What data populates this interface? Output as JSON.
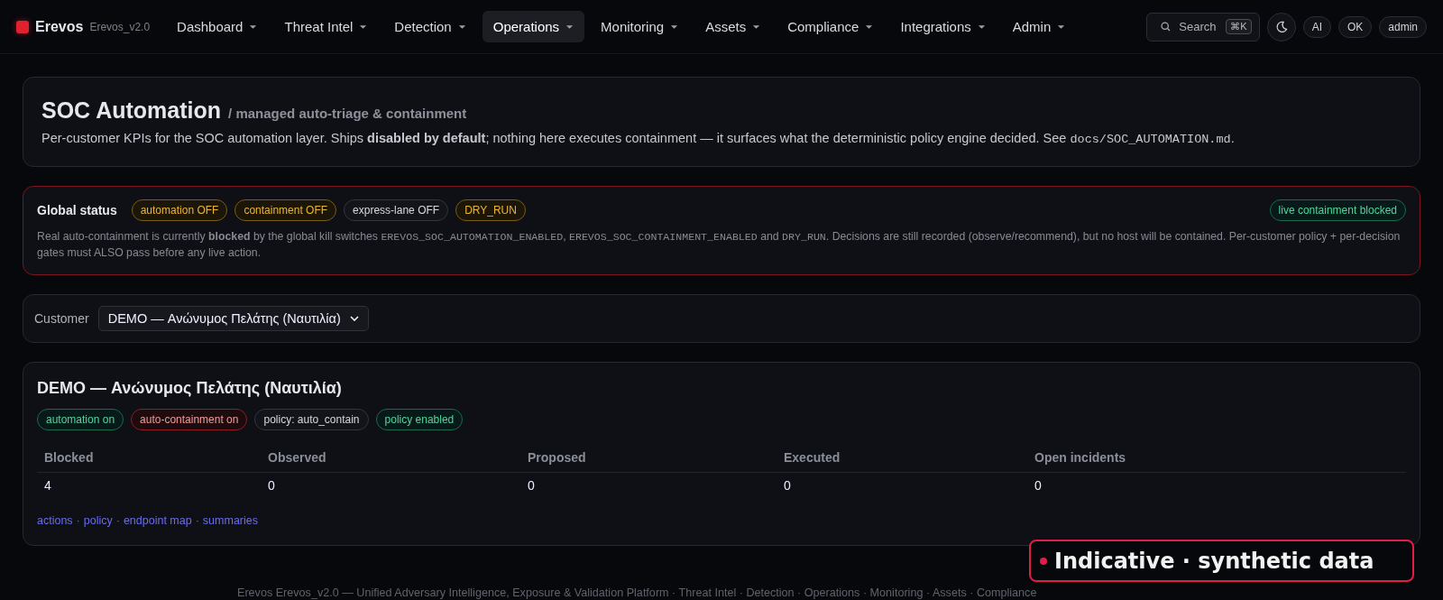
{
  "brand": {
    "name": "Erevos",
    "version": "Erevos_v2.0"
  },
  "nav": [
    {
      "label": "Dashboard",
      "selected": false
    },
    {
      "label": "Threat Intel",
      "selected": false
    },
    {
      "label": "Detection",
      "selected": false
    },
    {
      "label": "Operations",
      "selected": true
    },
    {
      "label": "Monitoring",
      "selected": false
    },
    {
      "label": "Assets",
      "selected": false
    },
    {
      "label": "Compliance",
      "selected": false
    },
    {
      "label": "Integrations",
      "selected": false
    },
    {
      "label": "Admin",
      "selected": false
    }
  ],
  "search": {
    "placeholder": "Search",
    "shortcut": "⌘K"
  },
  "header_buttons": [
    "AI",
    "OK",
    "admin"
  ],
  "header": {
    "title": "SOC Automation",
    "subtitle": "/ managed auto-triage & containment",
    "intro": [
      {
        "kind": "text",
        "text": "Per-customer KPIs for the SOC automation layer. Ships **disabled by default**; nothing here executes containment — it surfaces what the deterministic policy engine decided. See "
      },
      {
        "kind": "code",
        "text": "docs/SOC_AUTOMATION.md"
      },
      {
        "kind": "text",
        "text": "."
      }
    ]
  },
  "global_status": {
    "title": "Global status",
    "chips": [
      {
        "label": "automation OFF",
        "kind": "warn"
      },
      {
        "label": "containment OFF",
        "kind": "warn"
      },
      {
        "label": "express-lane OFF",
        "kind": "neutral"
      },
      {
        "label": "DRY_RUN",
        "kind": "warn"
      }
    ],
    "result": {
      "label": "live containment blocked",
      "kind": "ok"
    },
    "text": [
      {
        "kind": "text",
        "text": "Real auto-containment is currently **blocked** by the global kill switches "
      },
      {
        "kind": "code",
        "text": "EREVOS_SOC_AUTOMATION_ENABLED"
      },
      {
        "kind": "text",
        "text": ", "
      },
      {
        "kind": "code",
        "text": "EREVOS_SOC_CONTAINMENT_ENABLED"
      },
      {
        "kind": "text",
        "text": " and "
      },
      {
        "kind": "code",
        "text": "DRY_RUN"
      },
      {
        "kind": "text",
        "text": ". Decisions are still recorded (observe/recommend), but no host will be contained. Per-customer policy + per-decision gates must ALSO pass before any live action."
      }
    ]
  },
  "customer": {
    "label": "Customer",
    "value": "DEMO — Ανώνυμος Πελάτης (Ναυτιλία)"
  },
  "tenant": {
    "title": "DEMO — Ανώνυμος Πελάτης (Ναυτιλία)",
    "chips": [
      {
        "label": "automation on",
        "kind": "ok"
      },
      {
        "label": "auto-containment on",
        "kind": "danger"
      },
      {
        "label": "policy: auto_contain",
        "kind": "neutral"
      },
      {
        "label": "policy enabled",
        "kind": "ok"
      }
    ],
    "columns": [
      "Blocked",
      "Observed",
      "Proposed",
      "Executed",
      "Open incidents"
    ],
    "values": [
      "4",
      "0",
      "0",
      "0",
      "0"
    ],
    "links": [
      "actions",
      "policy",
      "endpoint map",
      "summaries"
    ],
    "link_separator": "·"
  },
  "footer": {
    "text": "Erevos Erevos_v2.0 — Unified Adversary Intelligence, Exposure & Validation Platform · Threat Intel · Detection · Operations · Monitoring · Assets · Compliance"
  },
  "notice": {
    "label": "Indicative · synthetic data",
    "color": "#e11d48"
  }
}
